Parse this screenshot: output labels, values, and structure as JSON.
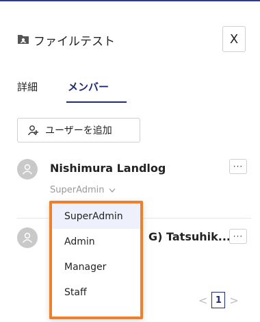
{
  "header": {
    "title": "ファイルテスト",
    "close_label": "X"
  },
  "tabs": [
    {
      "label": "詳細",
      "active": false
    },
    {
      "label": "メンバー",
      "active": true
    }
  ],
  "add_user_label": "ユーザーを追加",
  "members": [
    {
      "name": "Nishimura Landlog",
      "role": "SuperAdmin",
      "more": "···"
    },
    {
      "name": "G) Tatsuhik...",
      "more": "···"
    }
  ],
  "role_dropdown": {
    "options": [
      "SuperAdmin",
      "Admin",
      "Manager",
      "Staff"
    ],
    "selected": "SuperAdmin"
  },
  "pagination": {
    "prev": "<",
    "current": "1",
    "next": ">"
  },
  "colors": {
    "accent": "#1e2a78",
    "highlight_border": "#f07f2a"
  }
}
